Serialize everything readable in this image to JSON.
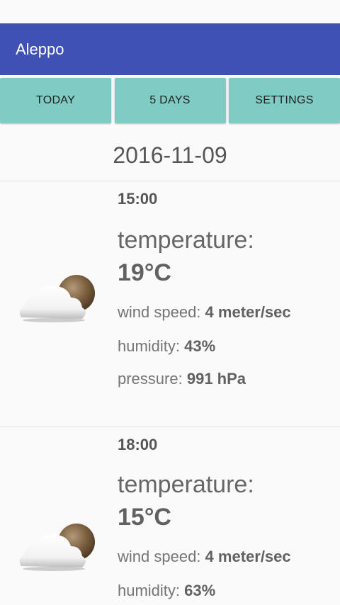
{
  "app_bar": {
    "title": "Aleppo"
  },
  "tabs": [
    {
      "label": "TODAY"
    },
    {
      "label": "5 DAYS"
    },
    {
      "label": "SETTINGS"
    }
  ],
  "date": "2016-11-09",
  "labels": {
    "temperature": "temperature:",
    "wind_speed": "wind speed:",
    "humidity": "humidity:",
    "pressure": "pressure:"
  },
  "forecasts": [
    {
      "time": "15:00",
      "temperature": "19°C",
      "wind_speed": "4 meter/sec",
      "humidity": "43%",
      "pressure": "991 hPa",
      "icon": "cloudy-night-icon"
    },
    {
      "time": "18:00",
      "temperature": "15°C",
      "wind_speed": "4 meter/sec",
      "humidity": "63%",
      "icon": "cloudy-night-icon"
    }
  ],
  "colors": {
    "app_bar": "#3f51b5",
    "tab": "#80cbc4",
    "background": "#fafafa"
  }
}
